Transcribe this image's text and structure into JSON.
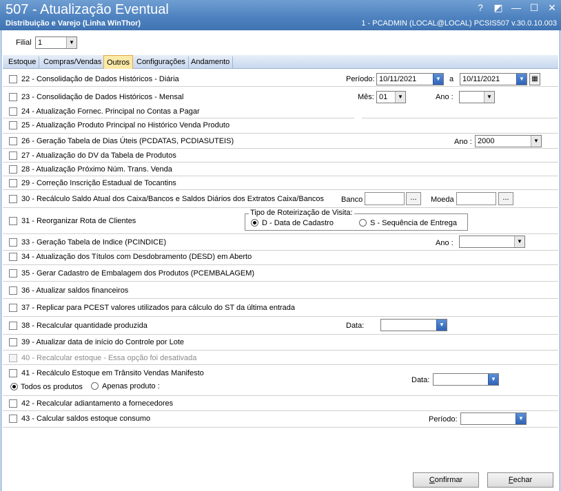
{
  "window": {
    "title": "507 - Atualização Eventual",
    "subtitle": "Distribuição e Varejo (Linha WinThor)",
    "userinfo": "1 - PCADMIN (LOCAL@LOCAL)   PCSIS507  v.30.0.10.003",
    "controls": [
      "?",
      "◩",
      "—",
      "☐",
      "✕"
    ]
  },
  "filial": {
    "label": "Filial",
    "value": "1"
  },
  "tabs": [
    "Estoque",
    "Compras/Vendas",
    "Outros",
    "Configurações",
    "Andamento"
  ],
  "active_tab": "Outros",
  "options": {
    "o22": "22 - Consolidação de Dados Históricos - Diária",
    "o23": "23 - Consolidação de Dados Históricos - Mensal",
    "o24": "24 - Atualização Fornec. Principal no Contas a Pagar",
    "o25": "25 - Atualização Produto Principal no Histórico Venda Produto",
    "o26": "26 - Geração Tabela de Dias Úteis (PCDATAS, PCDIASUTEIS)",
    "o27": "27 - Atualização do DV da Tabela de Produtos",
    "o28": "28 - Atualização Próximo Núm. Trans. Venda",
    "o29": "29 - Correção Inscrição Estadual de Tocantins",
    "o30": "30 - Recálculo Saldo Atual dos Caixa/Bancos e Saldos Diários dos Extratos Caixa/Bancos",
    "o31": "31 - Reorganizar Rota de Clientes",
    "o33": "33 - Geração Tabela de Indice (PCINDICE)",
    "o34": "34 - Atualização dos Títulos com Desdobramento (DESD) em Aberto",
    "o35": "35 - Gerar Cadastro de Embalagem dos Produtos (PCEMBALAGEM)",
    "o36": "36 - Atualizar saldos financeiros",
    "o37": "37 - Replicar para PCEST valores utilizados para cálculo do ST da última entrada",
    "o38": "38 - Recalcular quantidade produzida",
    "o39": "39 - Atualizar data de início do Controle por Lote",
    "o40": "40 - Recalcular estoque - Essa opção foi desativada",
    "o41": "41 - Recálculo Estoque em Trânsito Vendas Manifesto",
    "o42": "42 - Recalcular adiantamento a fornecedores",
    "o43": "43 - Calcular saldos estoque consumo"
  },
  "fields": {
    "periodo_label": "Período:",
    "periodo_from": "10/11/2021",
    "periodo_sep": "a",
    "periodo_to": "10/11/2021",
    "mes_label": "Mês:",
    "mes_value": "01",
    "ano_label": "Ano :",
    "ano26_label": "Ano :",
    "ano26_value": "2000",
    "banco_label": "Banco",
    "moeda_label": "Moeda",
    "ellipsis": "...",
    "roteirizacao_title": "Tipo de Roteirização de Visita:",
    "rot_opt_d": "D - Data de Cadastro",
    "rot_opt_s": "S - Sequência de Entrega",
    "ano33_label": "Ano :",
    "data38_label": "Data:",
    "todos_produtos": "Todos os produtos",
    "apenas_produto": "Apenas produto :",
    "data41_label": "Data:",
    "periodo43_label": "Período:"
  },
  "buttons": {
    "confirm_prefix": "C",
    "confirm_rest": "onfirmar",
    "close_prefix": "F",
    "close_rest": "echar"
  },
  "colors": {
    "titlebar": "#4f83c0",
    "active_tab": "#fbe9a7",
    "tab_strip": "#c8d8ee"
  }
}
